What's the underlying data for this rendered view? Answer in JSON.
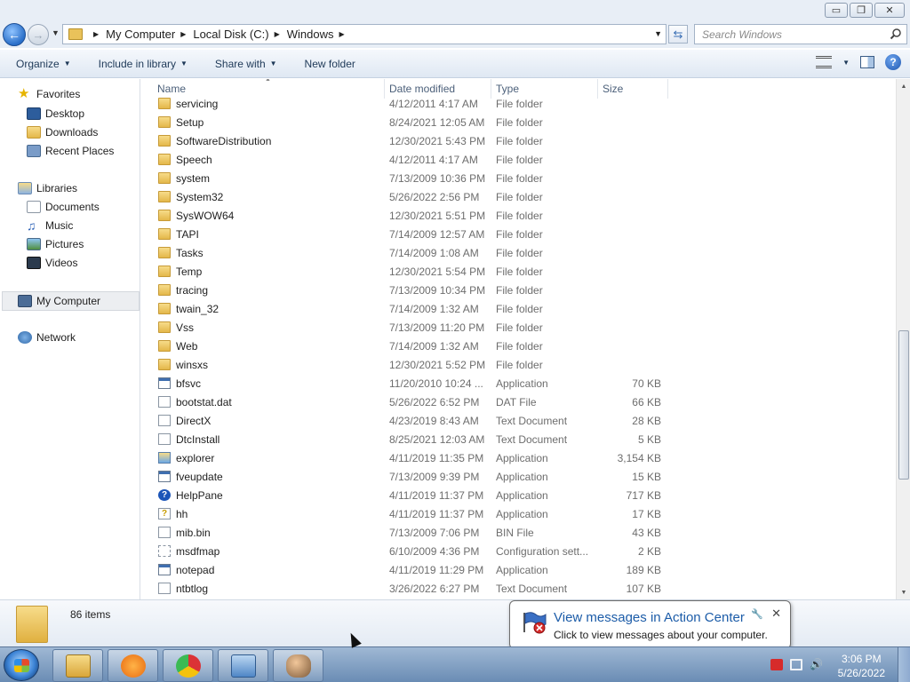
{
  "window": {
    "controls": {
      "minimize": "▭",
      "restore": "❐",
      "close": "✕"
    }
  },
  "address": {
    "breadcrumb": [
      "My Computer",
      "Local Disk (C:)",
      "Windows"
    ],
    "search_placeholder": "Search Windows"
  },
  "toolbar": {
    "organize": "Organize",
    "include_in_library": "Include in library",
    "share_with": "Share with",
    "new_folder": "New folder"
  },
  "nav": {
    "favorites": "Favorites",
    "desktop": "Desktop",
    "downloads": "Downloads",
    "recent_places": "Recent Places",
    "libraries": "Libraries",
    "documents": "Documents",
    "music": "Music",
    "pictures": "Pictures",
    "videos": "Videos",
    "my_computer": "My Computer",
    "network": "Network"
  },
  "columns": {
    "name": "Name",
    "date": "Date modified",
    "type": "Type",
    "size": "Size"
  },
  "files": [
    {
      "name": "servicing",
      "date": "4/12/2011 4:17 AM",
      "type": "File folder",
      "size": "",
      "icon": "folder"
    },
    {
      "name": "Setup",
      "date": "8/24/2021 12:05 AM",
      "type": "File folder",
      "size": "",
      "icon": "folder"
    },
    {
      "name": "SoftwareDistribution",
      "date": "12/30/2021 5:43 PM",
      "type": "File folder",
      "size": "",
      "icon": "folder"
    },
    {
      "name": "Speech",
      "date": "4/12/2011 4:17 AM",
      "type": "File folder",
      "size": "",
      "icon": "folder"
    },
    {
      "name": "system",
      "date": "7/13/2009 10:36 PM",
      "type": "File folder",
      "size": "",
      "icon": "folder"
    },
    {
      "name": "System32",
      "date": "5/26/2022 2:56 PM",
      "type": "File folder",
      "size": "",
      "icon": "folder"
    },
    {
      "name": "SysWOW64",
      "date": "12/30/2021 5:51 PM",
      "type": "File folder",
      "size": "",
      "icon": "folder"
    },
    {
      "name": "TAPI",
      "date": "7/14/2009 12:57 AM",
      "type": "File folder",
      "size": "",
      "icon": "folder"
    },
    {
      "name": "Tasks",
      "date": "7/14/2009 1:08 AM",
      "type": "File folder",
      "size": "",
      "icon": "folder"
    },
    {
      "name": "Temp",
      "date": "12/30/2021 5:54 PM",
      "type": "File folder",
      "size": "",
      "icon": "folder"
    },
    {
      "name": "tracing",
      "date": "7/13/2009 10:34 PM",
      "type": "File folder",
      "size": "",
      "icon": "folder"
    },
    {
      "name": "twain_32",
      "date": "7/14/2009 1:32 AM",
      "type": "File folder",
      "size": "",
      "icon": "folder"
    },
    {
      "name": "Vss",
      "date": "7/13/2009 11:20 PM",
      "type": "File folder",
      "size": "",
      "icon": "folder"
    },
    {
      "name": "Web",
      "date": "7/14/2009 1:32 AM",
      "type": "File folder",
      "size": "",
      "icon": "folder"
    },
    {
      "name": "winsxs",
      "date": "12/30/2021 5:52 PM",
      "type": "File folder",
      "size": "",
      "icon": "folder"
    },
    {
      "name": "bfsvc",
      "date": "11/20/2010 10:24 ...",
      "type": "Application",
      "size": "70 KB",
      "icon": "app"
    },
    {
      "name": "bootstat.dat",
      "date": "5/26/2022 6:52 PM",
      "type": "DAT File",
      "size": "66 KB",
      "icon": "doc"
    },
    {
      "name": "DirectX",
      "date": "4/23/2019 8:43 AM",
      "type": "Text Document",
      "size": "28 KB",
      "icon": "doc"
    },
    {
      "name": "DtcInstall",
      "date": "8/25/2021 12:03 AM",
      "type": "Text Document",
      "size": "5 KB",
      "icon": "doc"
    },
    {
      "name": "explorer",
      "date": "4/11/2019 11:35 PM",
      "type": "Application",
      "size": "3,154 KB",
      "icon": "explorer"
    },
    {
      "name": "fveupdate",
      "date": "7/13/2009 9:39 PM",
      "type": "Application",
      "size": "15 KB",
      "icon": "app"
    },
    {
      "name": "HelpPane",
      "date": "4/11/2019 11:37 PM",
      "type": "Application",
      "size": "717 KB",
      "icon": "help"
    },
    {
      "name": "hh",
      "date": "4/11/2019 11:37 PM",
      "type": "Application",
      "size": "17 KB",
      "icon": "hh"
    },
    {
      "name": "mib.bin",
      "date": "7/13/2009 7:06 PM",
      "type": "BIN File",
      "size": "43 KB",
      "icon": "doc"
    },
    {
      "name": "msdfmap",
      "date": "6/10/2009 4:36 PM",
      "type": "Configuration sett...",
      "size": "2 KB",
      "icon": "cfg"
    },
    {
      "name": "notepad",
      "date": "4/11/2019 11:29 PM",
      "type": "Application",
      "size": "189 KB",
      "icon": "app"
    },
    {
      "name": "ntbtlog",
      "date": "3/26/2022 6:27 PM",
      "type": "Text Document",
      "size": "107 KB",
      "icon": "doc"
    }
  ],
  "details": {
    "count": "86 items"
  },
  "notification": {
    "title": "View messages in Action Center",
    "subtitle": "Click to view messages about your computer."
  },
  "clock": {
    "time": "3:06 PM",
    "date": "5/26/2022"
  },
  "colors": {
    "accent": "#1c5ca8",
    "folder": "#e4b74a",
    "taskbar": "#6a8cb4"
  }
}
